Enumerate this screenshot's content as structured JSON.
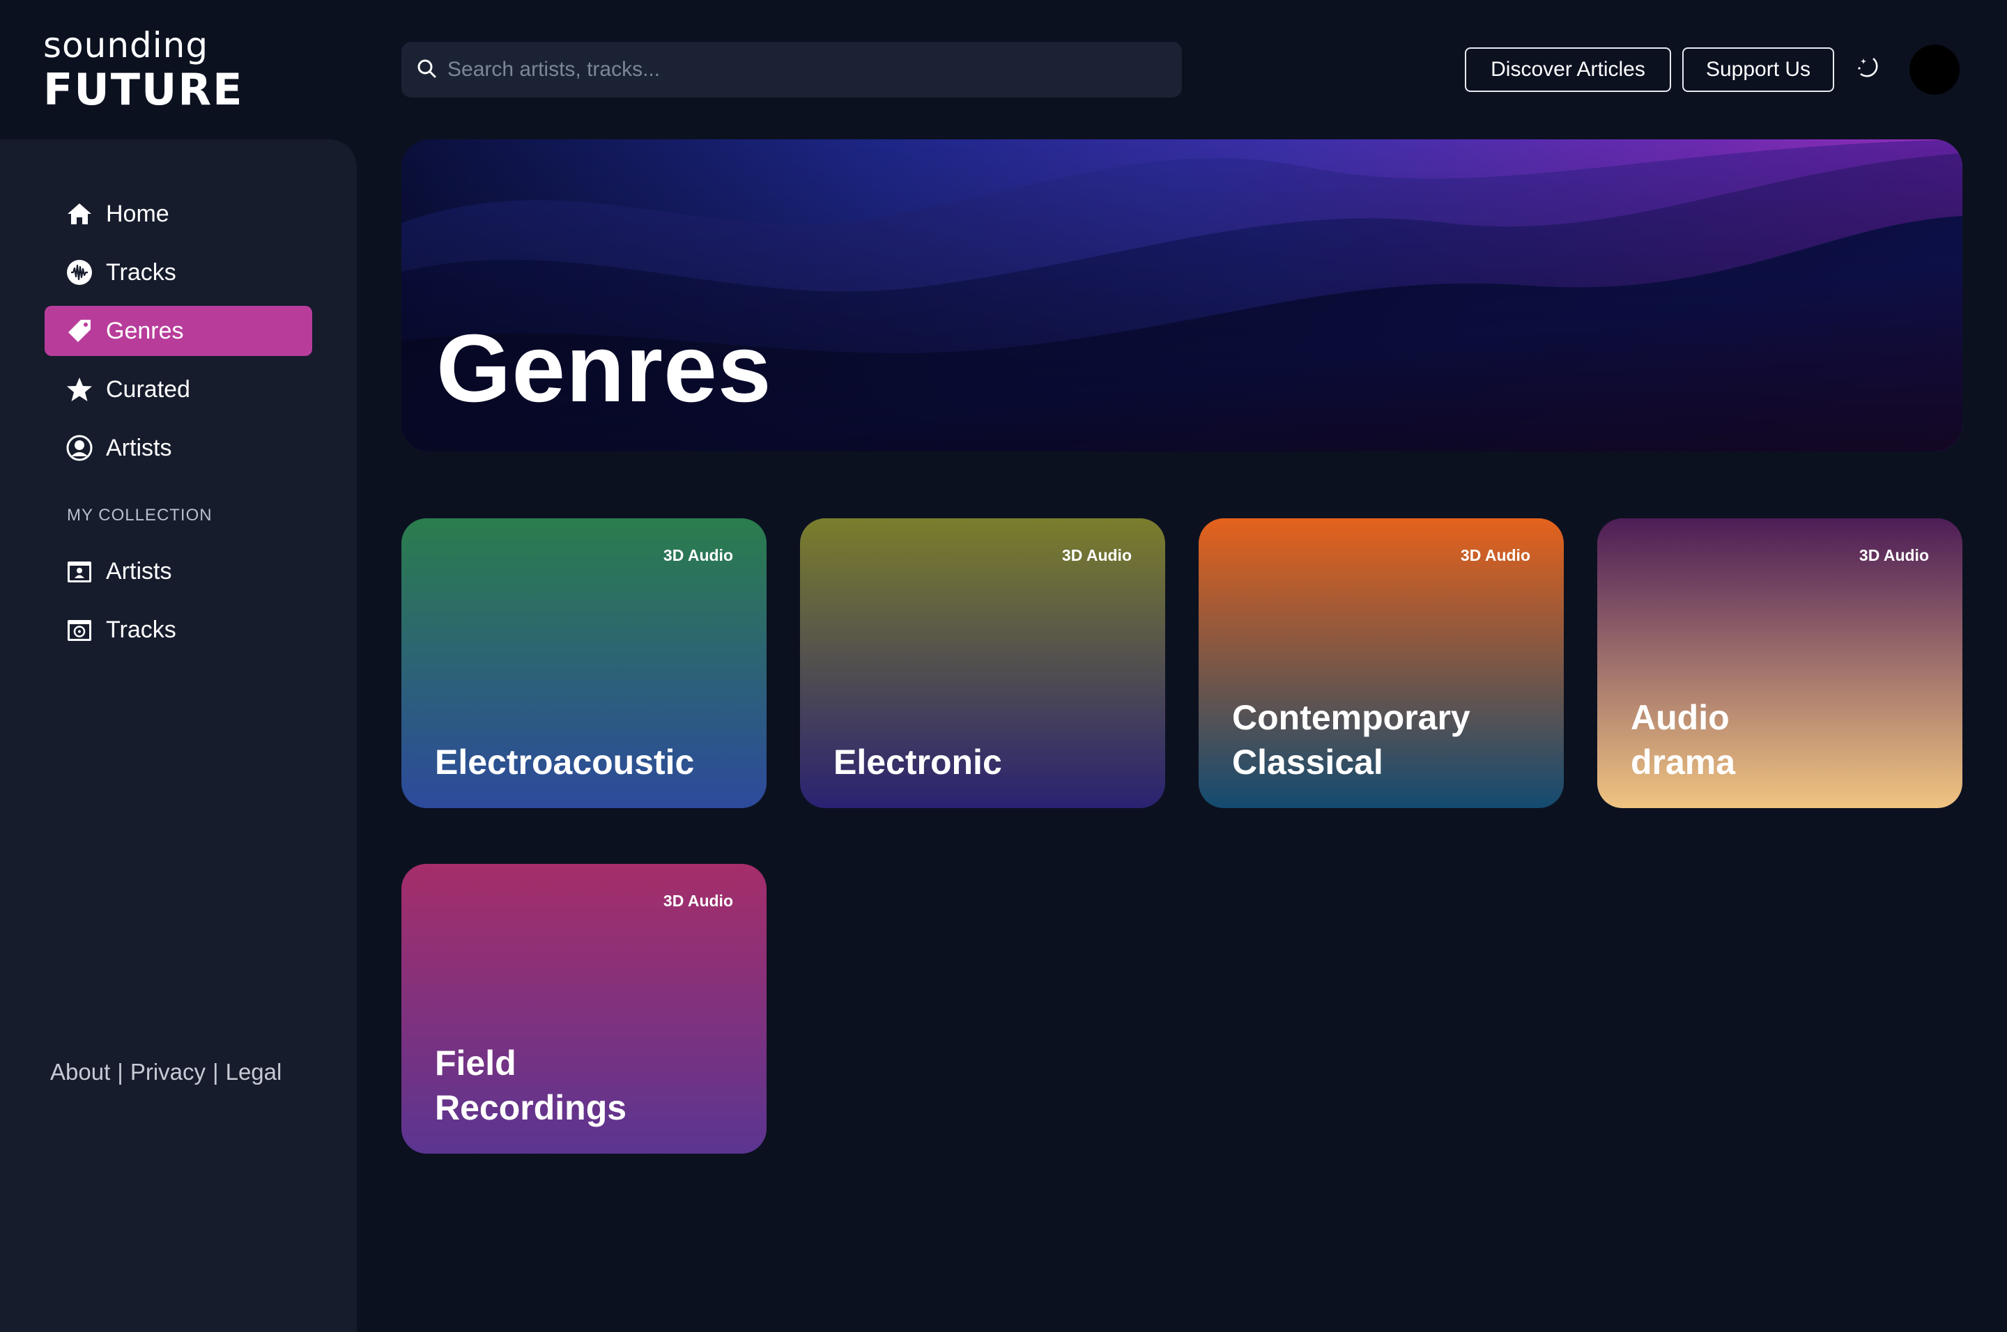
{
  "brand": {
    "line1": "sounding",
    "line2": "FUTURE"
  },
  "search": {
    "placeholder": "Search artists, tracks..."
  },
  "header": {
    "discover_label": "Discover Articles",
    "support_label": "Support Us",
    "theme_icon": "moon-stars-icon"
  },
  "sidebar": {
    "nav": [
      {
        "label": "Home",
        "icon": "home-icon"
      },
      {
        "label": "Tracks",
        "icon": "waveform-icon"
      },
      {
        "label": "Genres",
        "icon": "tag-icon",
        "active": true
      },
      {
        "label": "Curated",
        "icon": "star-icon"
      },
      {
        "label": "Artists",
        "icon": "user-circle-icon"
      }
    ],
    "collection_label": "MY COLLECTION",
    "collection": [
      {
        "label": "Artists",
        "icon": "folder-user-icon"
      },
      {
        "label": "Tracks",
        "icon": "folder-music-icon"
      }
    ],
    "footer": {
      "about": "About",
      "privacy": "Privacy",
      "legal": "Legal",
      "separator": "|"
    }
  },
  "hero": {
    "title": "Genres"
  },
  "genres": [
    {
      "name": "Electroacoustic",
      "badge": "3D Audio",
      "gradient": [
        "#2b7d4d",
        "#2d4a9c"
      ]
    },
    {
      "name": "Electronic",
      "badge": "3D Audio",
      "gradient": [
        "#7b7e2c",
        "#2a2272"
      ]
    },
    {
      "name": "Contemporary\nClassical",
      "badge": "3D Audio",
      "gradient": [
        "#e5621c",
        "#134b70"
      ]
    },
    {
      "name": "Audio\ndrama",
      "badge": "3D Audio",
      "gradient": [
        "#4d1d57",
        "#f0c481"
      ]
    },
    {
      "name": "Field\nRecordings",
      "badge": "3D Audio",
      "gradient": [
        "#a62e6a",
        "#5b3591"
      ]
    }
  ],
  "colors": {
    "background": "#0c1120",
    "sidebar": "#161c2c",
    "accent": "#b83d9b"
  }
}
